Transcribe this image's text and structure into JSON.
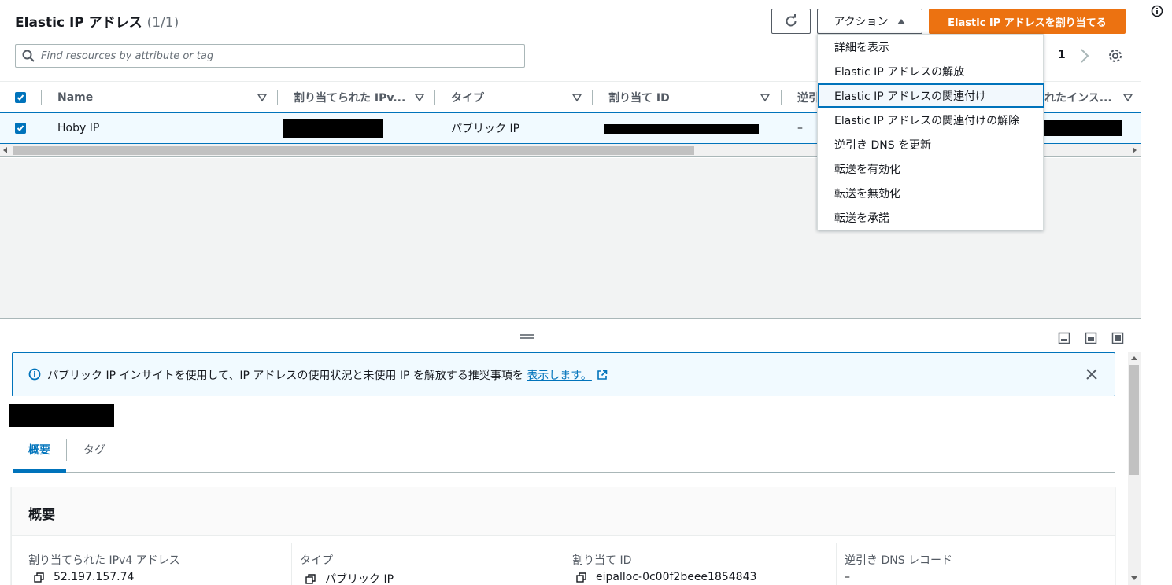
{
  "page": {
    "title": "Elastic IP アドレス",
    "count": "(1/1)"
  },
  "toolbar": {
    "action_label": "アクション",
    "primary_label": "Elastic IP アドレスを割り当てる"
  },
  "search": {
    "placeholder": "Find resources by attribute or tag"
  },
  "pagination": {
    "current": "1"
  },
  "table": {
    "columns": [
      {
        "label": "Name"
      },
      {
        "label": "割り当てられた IPv..."
      },
      {
        "label": "タイプ"
      },
      {
        "label": "割り当て ID"
      },
      {
        "label": "逆引"
      },
      {
        "label": "れたインス..."
      }
    ],
    "rows": [
      {
        "name": "Hoby IP",
        "type": "パブリック IP",
        "reverse_dns": "–"
      }
    ]
  },
  "dropdown": {
    "items": [
      {
        "label": "詳細を表示"
      },
      {
        "label": "Elastic IP アドレスの解放"
      },
      {
        "label": "Elastic IP アドレスの関連付け"
      },
      {
        "label": "Elastic IP アドレスの関連付けの解除"
      },
      {
        "label": "逆引き DNS を更新"
      },
      {
        "label": "転送を有効化"
      },
      {
        "label": "転送を無効化"
      },
      {
        "label": "転送を承諾"
      }
    ],
    "highlighted_index": 2
  },
  "banner": {
    "text": "パブリック IP インサイトを使用して、IP アドレスの使用状況と未使用 IP を解放する推奨事項を",
    "link": "表示します。"
  },
  "tabs": [
    {
      "label": "概要"
    },
    {
      "label": "タグ"
    }
  ],
  "summary": {
    "title": "概要",
    "fields": [
      {
        "label": "割り当てられた IPv4 アドレス",
        "value": "52.197.157.74"
      },
      {
        "label": "タイプ",
        "value": "パブリック IP"
      },
      {
        "label": "割り当て ID",
        "value": "eipalloc-0c00f2beee1854843"
      },
      {
        "label": "逆引き DNS レコード",
        "value": "–"
      }
    ]
  },
  "colors": {
    "primary": "#ec7211",
    "link": "#0073bb",
    "text": "#16191f"
  }
}
